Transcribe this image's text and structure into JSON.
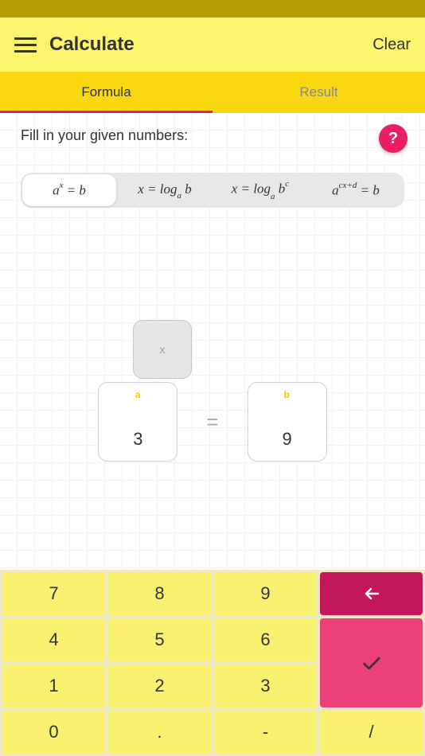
{
  "header": {
    "title": "Calculate",
    "clear_label": "Clear"
  },
  "tabs": {
    "formula": "Formula",
    "result": "Result",
    "active": "formula"
  },
  "instruction": "Fill in your given numbers:",
  "help_label": "?",
  "formula_options": [
    {
      "html": "a<sup>x</sup> = b",
      "selected": true
    },
    {
      "html": "x = log<sub>a</sub> b",
      "selected": false
    },
    {
      "html": "x = log<sub>a</sub> b<sup>c</sup>",
      "selected": false
    },
    {
      "html": "a<sup>cx+d</sup> = b",
      "selected": false
    }
  ],
  "equation": {
    "unknown_label": "x",
    "a_label": "a",
    "a_value": "3",
    "b_label": "b",
    "b_value": "9",
    "equals": "="
  },
  "keypad": {
    "k7": "7",
    "k8": "8",
    "k9": "9",
    "k4": "4",
    "k5": "5",
    "k6": "6",
    "k1": "1",
    "k2": "2",
    "k3": "3",
    "k0": "0",
    "kdot": ".",
    "kminus": "-",
    "kdiv": "/",
    "back": "←",
    "confirm": "✓"
  }
}
